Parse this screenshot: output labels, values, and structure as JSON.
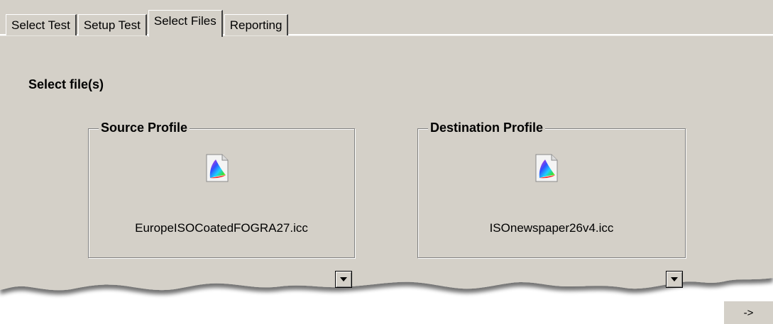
{
  "tabs": [
    {
      "label": "Select Test"
    },
    {
      "label": "Setup Test"
    },
    {
      "label": "Select Files"
    },
    {
      "label": "Reporting"
    }
  ],
  "active_tab": "Select Files",
  "section_title": "Select file(s)",
  "source": {
    "legend": "Source Profile",
    "file_name": "EuropeISOCoatedFOGRA27.icc"
  },
  "destination": {
    "legend": "Destination Profile",
    "file_name": "ISOnewspaper26v4.icc"
  },
  "next_button": {
    "label": "->"
  },
  "colors": {
    "panel": "#d4d0c8",
    "background": "#ffffff"
  }
}
